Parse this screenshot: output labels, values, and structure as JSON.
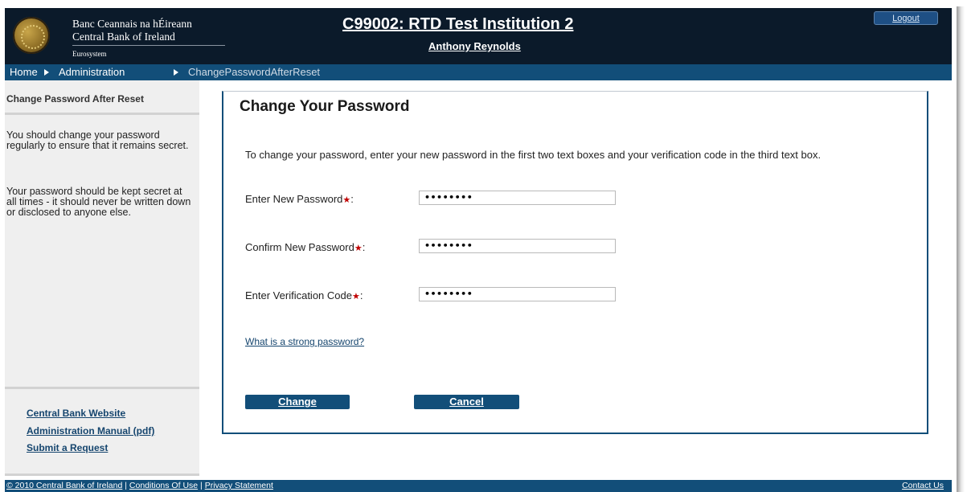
{
  "header": {
    "bank_name_irish": "Banc Ceannais na hÉireann",
    "bank_name_english": "Central Bank of Ireland",
    "eurosystem": "Eurosystem",
    "institution_title": "C99002: RTD Test Institution 2",
    "user_name": "Anthony Reynolds",
    "logout_label": "Logout"
  },
  "breadcrumb": {
    "items": [
      "Home",
      "Administration"
    ],
    "current": "ChangePasswordAfterReset"
  },
  "sidebar": {
    "title": "Change Password After Reset",
    "para1": "You should change your password regularly to ensure that it remains secret.",
    "para2": "Your password should be kept secret at all times - it should never be written down or disclosed to anyone else.",
    "links": [
      "Central Bank Website",
      "Administration Manual (pdf)",
      "Submit a Request"
    ]
  },
  "main": {
    "title": "Change Your Password",
    "intro": "To change your password, enter your new password in the first two text boxes and your verification code in the third text box.",
    "fields": [
      {
        "label": "Enter New Password",
        "value": "••••••••"
      },
      {
        "label": "Confirm New Password",
        "value": "••••••••"
      },
      {
        "label": "Enter Verification Code",
        "value": "••••••••"
      }
    ],
    "required_marker": "★",
    "colon": ":",
    "strong_link": "What is a strong password?",
    "change_label": "Change",
    "cancel_label": "Cancel"
  },
  "footer": {
    "copyright": "© 2010 Central Bank of Ireland",
    "conditions": "Conditions Of Use",
    "privacy": "Privacy Statement",
    "separator": "|",
    "contact": "Contact Us"
  },
  "colors": {
    "header_bg": "#0b1a2a",
    "nav_bg": "#124e79",
    "sidebar_bg": "#efefef",
    "required": "#c00000"
  }
}
